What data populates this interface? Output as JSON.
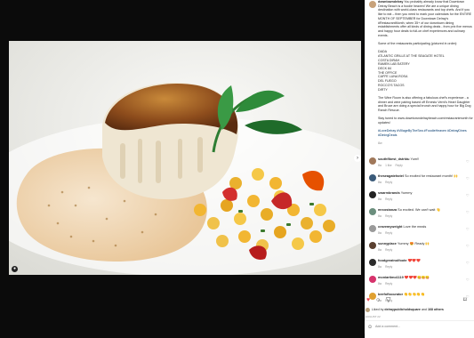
{
  "caption": {
    "username": "downtowndelray",
    "p1": "You probably already know that Downtown Delray Beach is a foodie heaven! We are a unique dining destination with world-class restaurants and top chefs. And if you like to eat – then you need to mark your calendars for the ENTIRE MONTH OF SEPTEMBER for Downtown Delray's #RestaurantMonth, when 35+ of our downtown dining establishments offer all kinds of dining deals - from prix fixe menus and happy hour deals to full-on chef experiences and culinary events.",
    "p2": "Some of the restaurants participating (pictured in order):",
    "restaurants": [
      "DADA",
      "ATLANTIC GRILLE AT THE SEAGATE HOTEL",
      "COSTA DIRAH",
      "RAMEN LAB EATERY",
      "DECK 84",
      "THE OFFICE",
      "CAFFE LUNA ROSA",
      "DEL FUEGO",
      "ROCCO'S TACOS",
      "DIRTY"
    ],
    "p3": "The Wine Room is also offering a fabulous chef's experience - a dinner and wine pairing based off Ernesto Verni's Heart Daughter and Bruce are doing a special brunch and happy hour for Big Dog Ranch Rescue.",
    "p4": "Stay tuned to www.downtowndelraybeach.com/restaurantmonth for updates!",
    "hashtags": "#LoveDelray #VillageByTheSea #FoodieHeaven #DelrayDines #DiningDeals",
    "age": "8w"
  },
  "comments": [
    {
      "user": "southflbest_dstrktu",
      "text": "Yum!!",
      "age": "8w",
      "likes": "1 like",
      "reply": "Reply",
      "color": "#a0785a"
    },
    {
      "user": "theseagatehotel",
      "text": "So excited for restaurant month! 🙌",
      "age": "8w",
      "likes": "",
      "reply": "Reply",
      "color": "#3b5b7a"
    },
    {
      "user": "swarmbrands",
      "text": "Yummy",
      "age": "8w",
      "likes": "",
      "reply": "Reply",
      "color": "#222222"
    },
    {
      "user": "mrcostanza",
      "text": "So excited. We can't wait 👋",
      "age": "8w",
      "likes": "",
      "reply": "Reply",
      "color": "#6b8e7d"
    },
    {
      "user": "cravemyweight",
      "text": "Love the meals",
      "age": "8w",
      "likes": "",
      "reply": "Reply",
      "color": "#9a9a9a"
    },
    {
      "user": "sunnyplace",
      "text": "Yummy 😍 Ready 🙌",
      "age": "8w",
      "likes": "",
      "reply": "Reply",
      "color": "#5a4030"
    },
    {
      "user": "foodgreatnolfoote",
      "text": "❤️❤️❤️",
      "age": "8w",
      "likes": "",
      "reply": "Reply",
      "color": "#2c2c2c"
    },
    {
      "user": "moniartimo1119",
      "text": "❤️❤️❤️😋😋😋",
      "age": "8w",
      "likes": "",
      "reply": "Reply",
      "color": "#d6336c"
    },
    {
      "user": "beefoftocurator",
      "text": "👏👏👏👏👏",
      "age": "8w",
      "likes": "",
      "reply": "Reply",
      "color": "#e0a030"
    }
  ],
  "actions": {
    "like": "heart-icon",
    "comment": "comment-icon",
    "share": "share-icon",
    "save": "bookmark-icon",
    "like_color": "#ed4956"
  },
  "likes": {
    "prefix": "Liked by",
    "user": "delraypublicholdsquare",
    "middle": "and",
    "count": "168 others"
  },
  "post_date": "AUGUST 22",
  "add_comment": {
    "placeholder": "Add a comment..."
  },
  "colors": {
    "background": "#7fd0cf",
    "dark": "#0b0b0b",
    "link": "#00376b"
  }
}
